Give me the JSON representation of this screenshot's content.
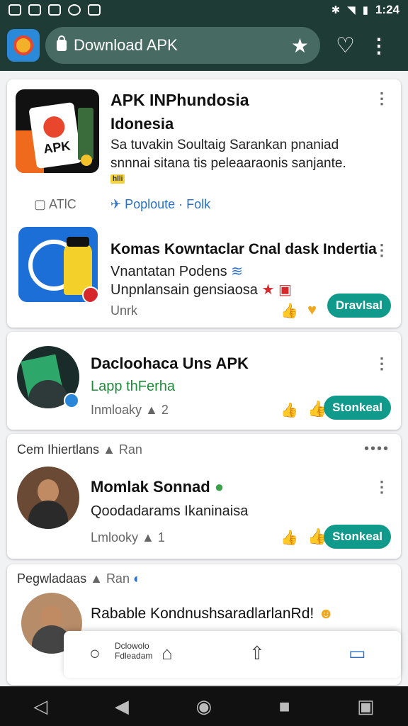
{
  "status_bar": {
    "time": "1:24"
  },
  "toolbar": {
    "url_text": "Download APK"
  },
  "cards": {
    "apk_header": {
      "title": "APK INPhundosia",
      "subtitle": "Idonesia",
      "desc_line1": "Sa tuvakin Soultaig Sarankan pnaniad",
      "desc_line2": "snnnai sitana tis peleaaraonis sanjante.",
      "badge": "hlli",
      "left_tag": "ATlC",
      "right_tag": "Poploute · Folk"
    },
    "komas": {
      "title": "Komas Kowntaclar Cnal dask Indertia",
      "line1": "Vnantatan Podens",
      "line2": "Unpnlansain gensiaosa",
      "meta": "Unrk",
      "action": "Dravlsal"
    },
    "dacloohaca": {
      "title": "Dacloohaca Uns APK",
      "subtitle": "Lapp thFerha",
      "meta": "Inmloaky",
      "meta_count": "2",
      "action": "Stonkeal"
    },
    "section1": {
      "label": "Cem Ihiertlans",
      "extra": "Ran"
    },
    "momlak": {
      "title": "Momlak Sonnad",
      "line1": "Qoodadarams Ikaninaisa",
      "meta": "Lmlooky",
      "meta_count": "1",
      "action": "Stonkeal"
    },
    "section2": {
      "label": "Pegwladaas",
      "extra": "Ran"
    },
    "rabable": {
      "title": "Rabable KondnushsaradlarlanRd!"
    }
  },
  "float_bar": {
    "text_line1": "Dclowolo",
    "text_line2": "Fdleadam"
  }
}
